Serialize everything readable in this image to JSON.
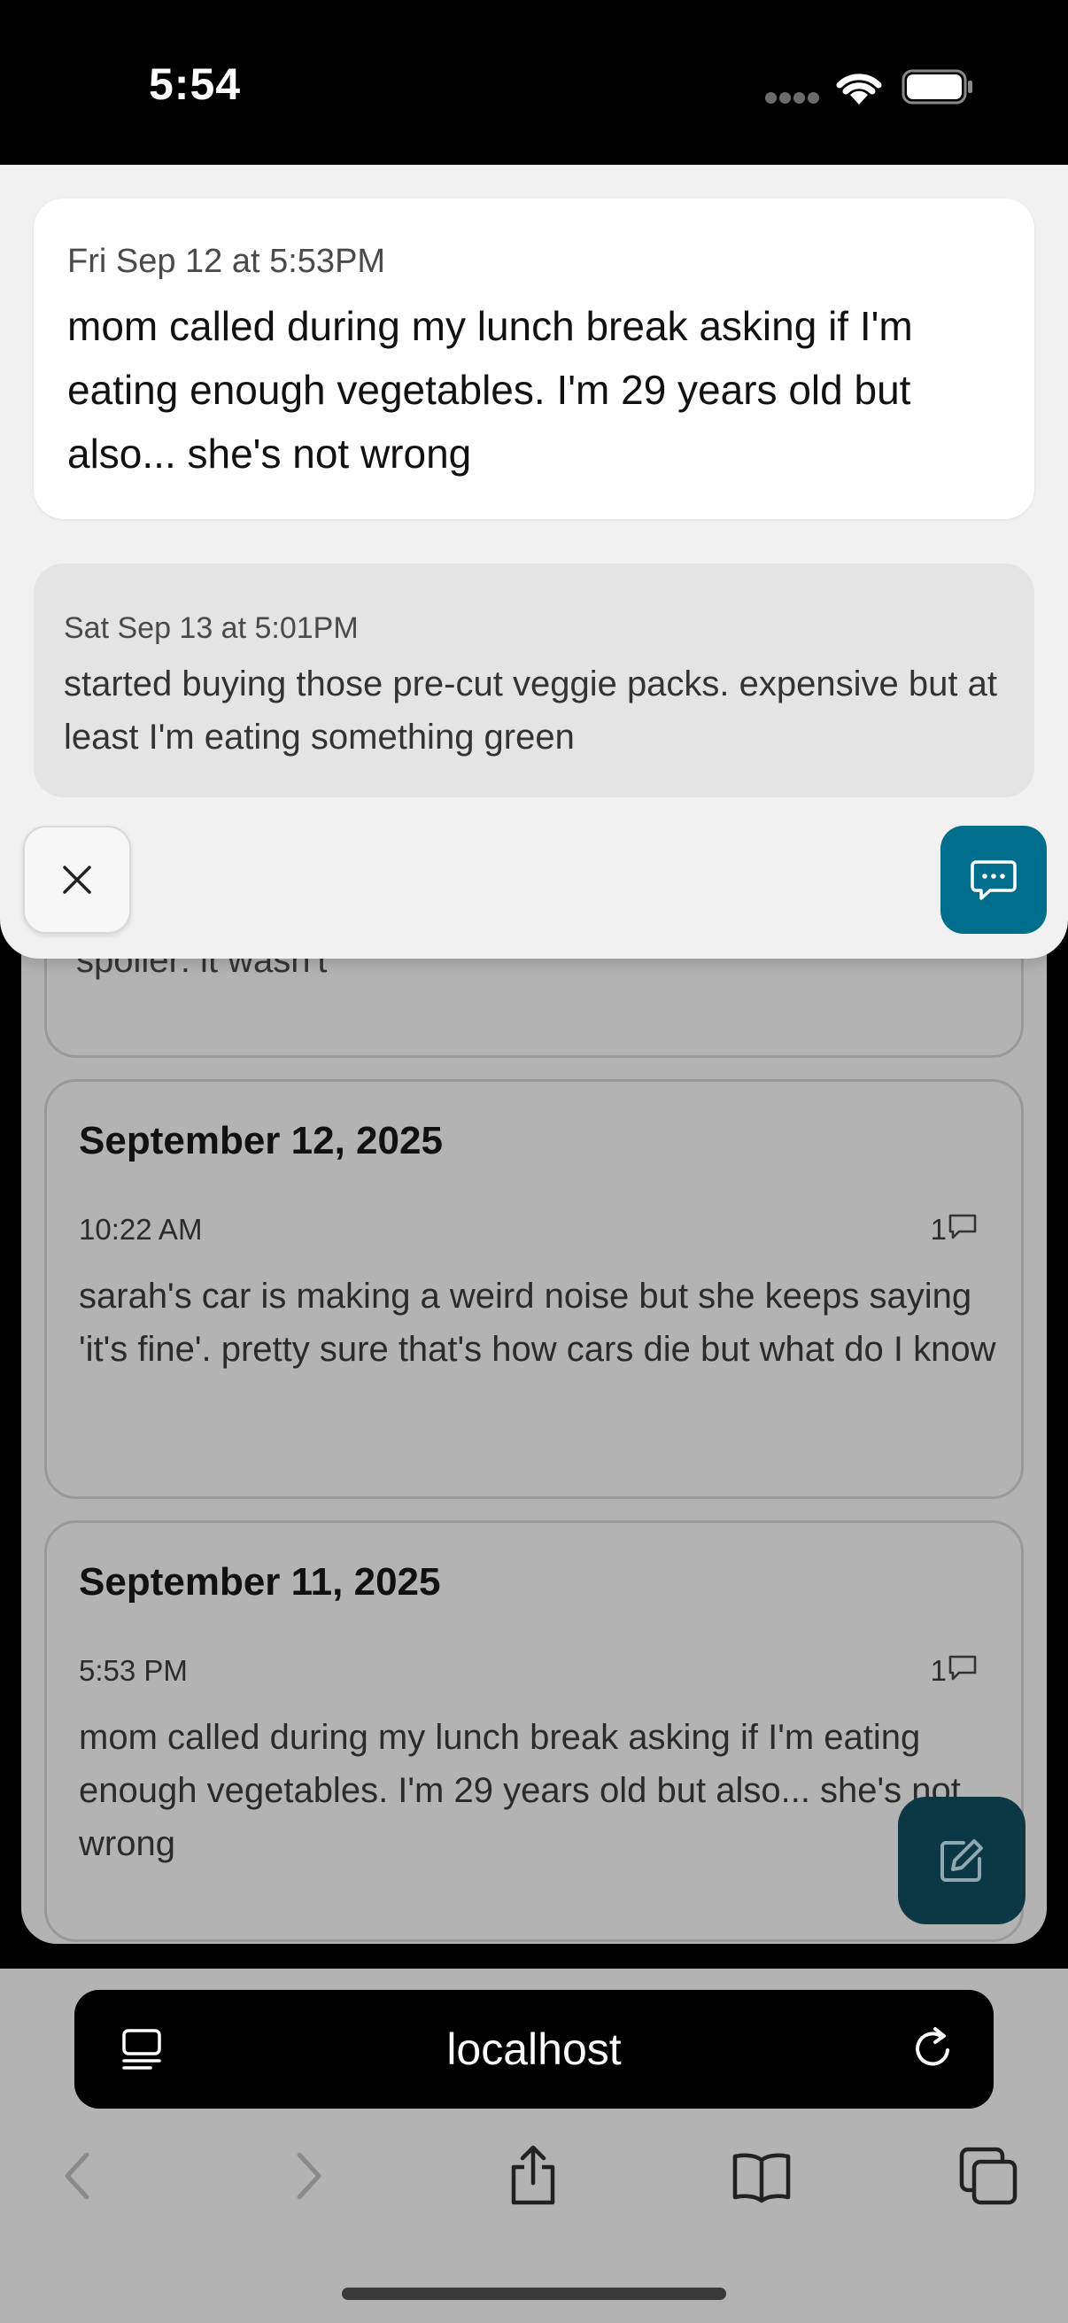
{
  "status_bar": {
    "time": "5:54"
  },
  "sheet": {
    "messages": [
      {
        "meta": "Fri Sep 12 at 5:53PM",
        "text": "mom called during my lunch break asking if I'm eating enough vegetables. I'm 29 years old but also... she's not wrong"
      },
      {
        "meta": "Sat Sep 13 at 5:01PM",
        "text": "started buying those pre-cut veggie packs. expensive but at least I'm eating something green"
      }
    ]
  },
  "background": {
    "partial_text": "spoiler: it wasn't",
    "entries": [
      {
        "date": "September 12, 2025",
        "time": "10:22 AM",
        "comment_count": "1",
        "text": "sarah's car is making a weird noise but she keeps saying 'it's fine'. pretty sure that's how cars die but what do I know"
      },
      {
        "date": "September 11, 2025",
        "time": "5:53 PM",
        "comment_count": "1",
        "text": "mom called during my lunch break asking if I'm eating enough vegetables. I'm 29 years old but also... she's not wrong"
      }
    ]
  },
  "browser": {
    "address": "localhost"
  },
  "colors": {
    "accent": "#006e8c",
    "fab": "#0c3745",
    "dim_background": "#b3b3b3"
  }
}
